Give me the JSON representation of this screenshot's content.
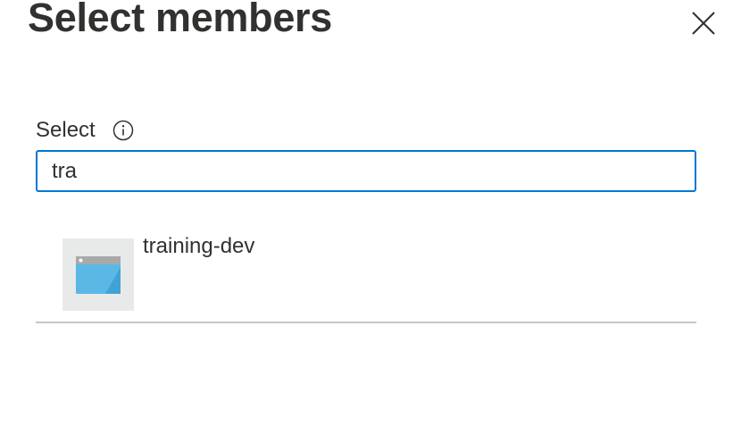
{
  "panel": {
    "title": "Select members"
  },
  "icons": {
    "close": "close-icon",
    "info": "info-icon",
    "app": "app-window-icon"
  },
  "search": {
    "label": "Select",
    "value": "tra",
    "focus_color": "#0078d4"
  },
  "results": [
    {
      "name": "training-dev"
    }
  ]
}
